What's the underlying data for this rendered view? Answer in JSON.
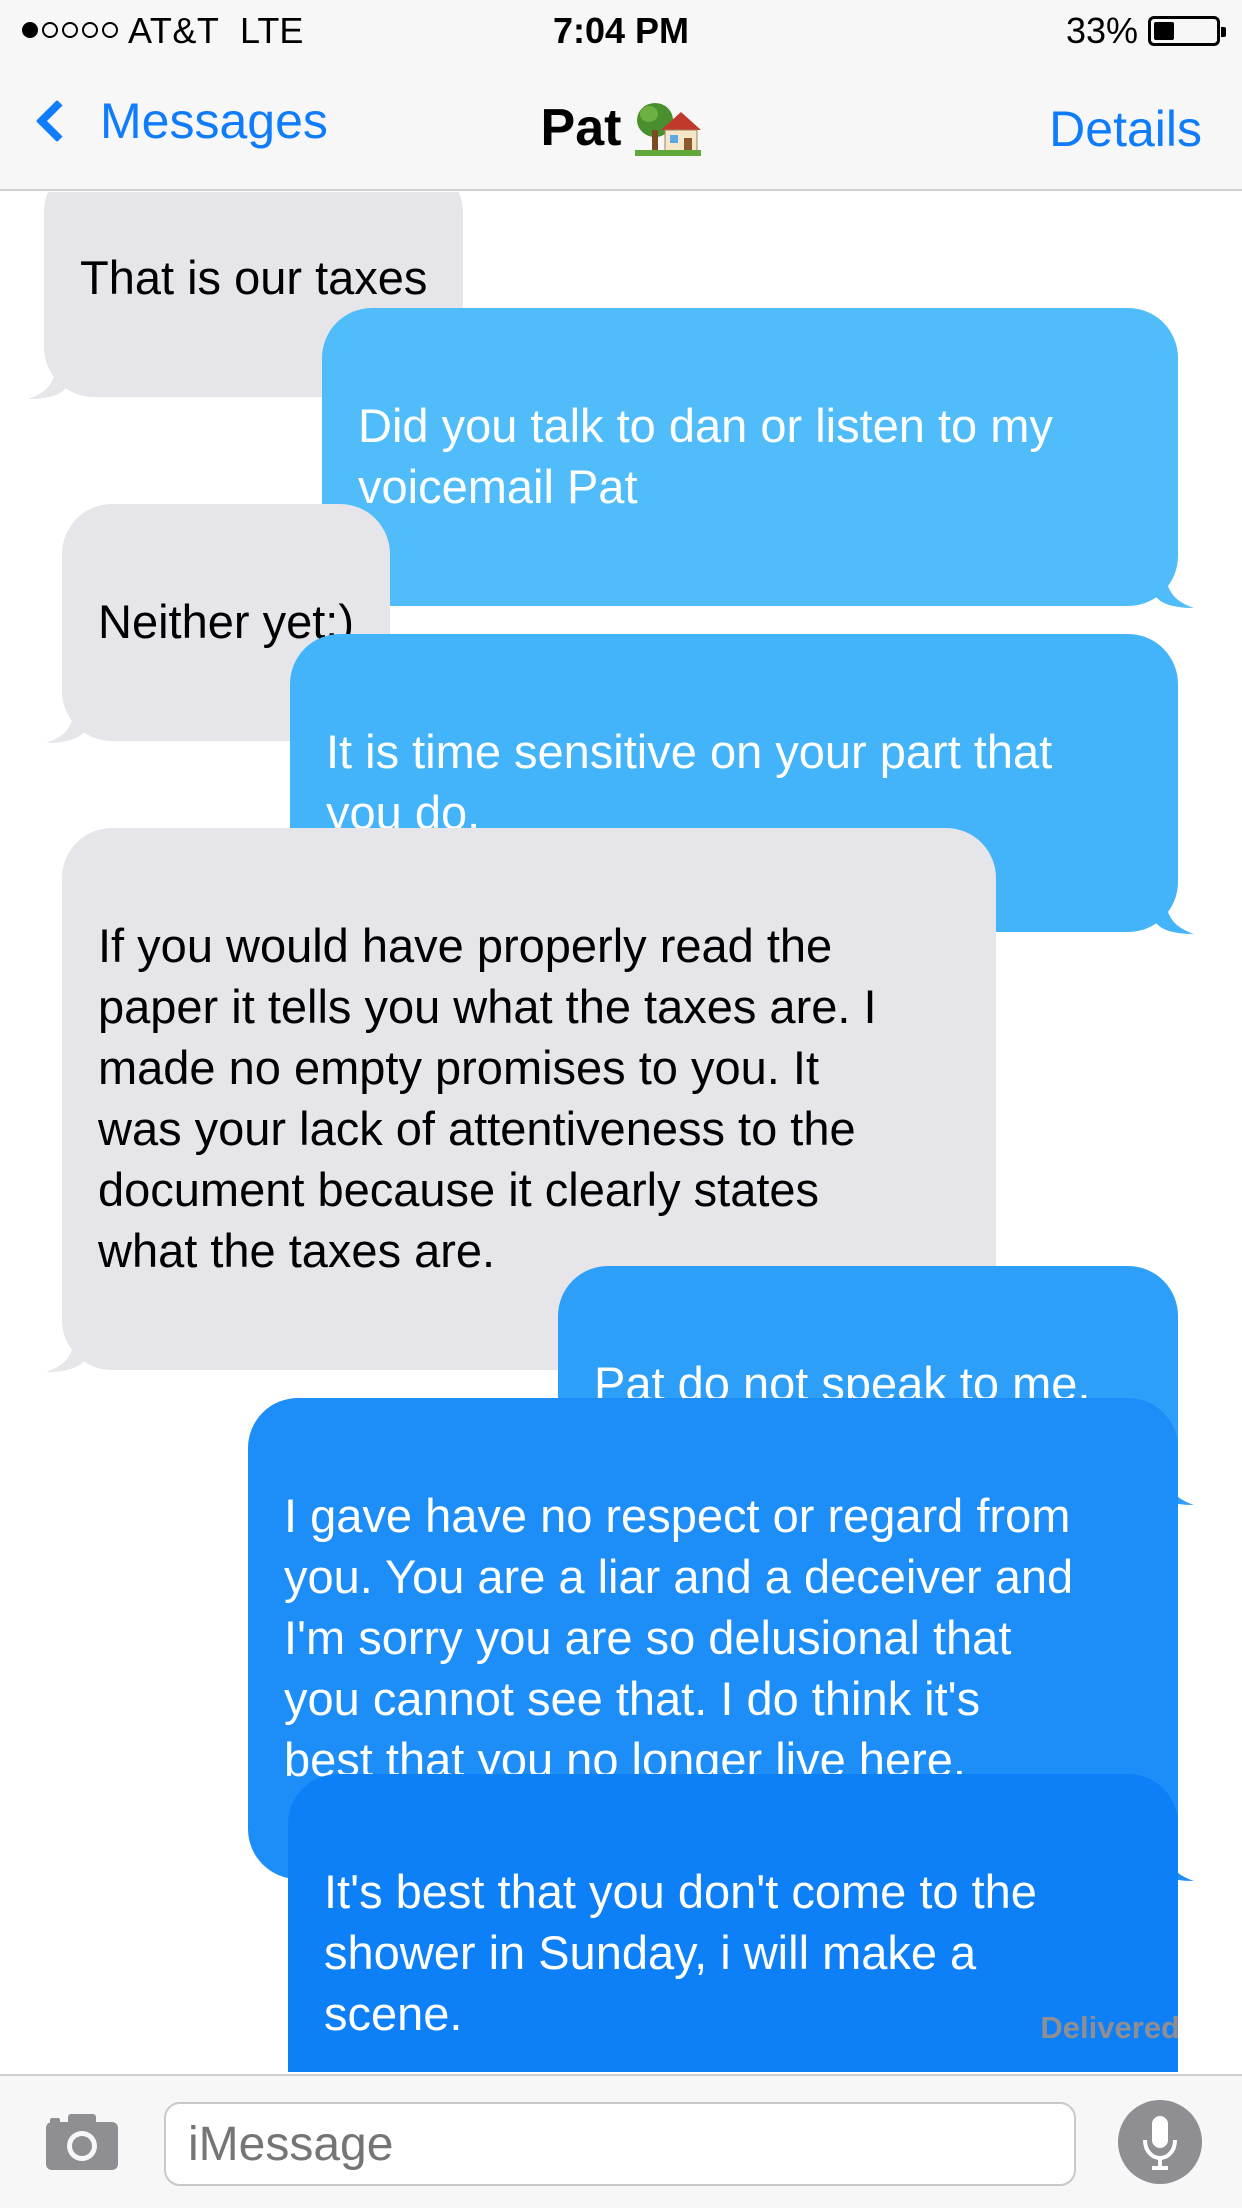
{
  "status_bar": {
    "signal_bars_filled": 1,
    "signal_bars_total": 5,
    "carrier": "AT&T",
    "network": "LTE",
    "time": "7:04 PM",
    "battery_percent": "33%",
    "battery_level": 0.33
  },
  "nav": {
    "back_label": "Messages",
    "contact_name": "Pat",
    "contact_emoji": "house-with-garden-icon",
    "details_label": "Details"
  },
  "messages": [
    {
      "from": "them",
      "text": "That is our taxes"
    },
    {
      "from": "me",
      "text": "Did you talk to dan or listen to my\nvoicemail Pat"
    },
    {
      "from": "them",
      "text": "Neither yet:)"
    },
    {
      "from": "me",
      "text": "It is time sensitive on your part that\nyou do."
    },
    {
      "from": "them",
      "text": " If you would have properly read the\npaper it tells you what the taxes are. I\nmade no empty promises to you. It\nwas your lack of attentiveness to the\ndocument because it clearly states\nwhat the taxes are."
    },
    {
      "from": "me",
      "text": "Pat do not speak to me."
    },
    {
      "from": "me",
      "text": "I gave have no respect or regard from\nyou. You are a liar and a deceiver and\nI'm sorry you are so delusional that\nyou cannot see that. I do think it's\nbest that you no longer live here."
    },
    {
      "from": "me",
      "text": "It's best that you don't come to the\nshower in Sunday, i will make a\nscene."
    }
  ],
  "delivered_label": "Delivered",
  "input": {
    "placeholder": "iMessage"
  },
  "colors": {
    "ios_blue": "#0f7cfb",
    "incoming_bubble": "#e5e5ea",
    "outgoing_gradient_top": "#5ac3fb",
    "outgoing_gradient_bottom": "#0a7aff"
  }
}
